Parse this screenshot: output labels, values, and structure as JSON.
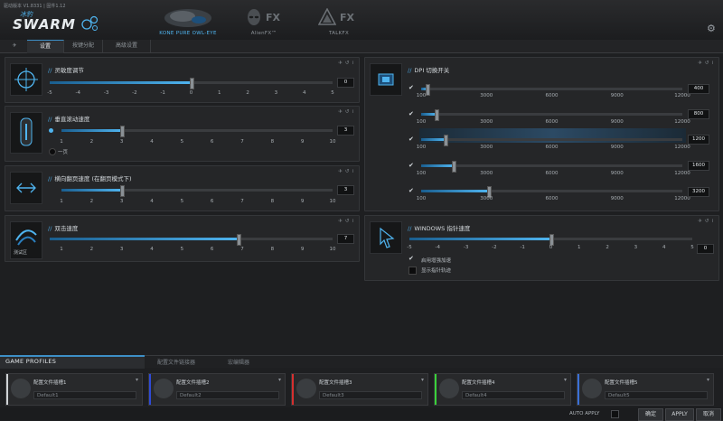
{
  "header": {
    "version_text": "驱动版本 V1.8331 | 固件1.12",
    "brand_cn": "冰豹",
    "brand": "SWARM",
    "nav": [
      {
        "label": "KONE PURE OWL-EYE"
      },
      {
        "label": "AlienFX™"
      },
      {
        "label": "TALKFX"
      }
    ],
    "fx_mark": "FX"
  },
  "tabs": [
    {
      "label": "✈"
    },
    {
      "label": "设置"
    },
    {
      "label": "按键分配"
    },
    {
      "label": "高级设置"
    }
  ],
  "panels": {
    "sensitivity": {
      "title": "灵敏度调节",
      "ticks": [
        "-5",
        "-4",
        "-3",
        "-2",
        "-1",
        "0",
        "1",
        "2",
        "3",
        "4",
        "5"
      ],
      "value": "0",
      "level": 0.5
    },
    "vscroll": {
      "title": "垂直滚动速度",
      "ticks": [
        "1",
        "2",
        "3",
        "4",
        "5",
        "6",
        "7",
        "8",
        "9",
        "10"
      ],
      "value": "3",
      "level": 0.222,
      "option": "一页"
    },
    "hscroll": {
      "title": "横向翻页速度 (在翻页模式下)",
      "ticks": [
        "1",
        "2",
        "3",
        "4",
        "5",
        "6",
        "7",
        "8",
        "9",
        "10"
      ],
      "value": "3",
      "level": 0.222
    },
    "dblclick": {
      "title": "双击速度",
      "ticks": [
        "1",
        "2",
        "3",
        "4",
        "5",
        "6",
        "7",
        "8",
        "9",
        "10"
      ],
      "value": "7",
      "level": 0.667,
      "thumb_label": "测试区"
    },
    "dpi": {
      "title": "DPI 切换开关",
      "ticks": [
        "100",
        "3000",
        "6000",
        "9000",
        "12000"
      ],
      "levels": [
        {
          "value": "400",
          "level": 0.025
        },
        {
          "value": "800",
          "level": 0.059
        },
        {
          "value": "1200",
          "level": 0.092
        },
        {
          "value": "1600",
          "level": 0.126
        },
        {
          "value": "3200",
          "level": 0.26
        }
      ]
    },
    "pointer": {
      "title": "WINDOWS 指针速度",
      "ticks": [
        "-5",
        "-4",
        "-3",
        "-2",
        "-1",
        "0",
        "1",
        "2",
        "3",
        "4",
        "5"
      ],
      "value": "0",
      "level": 0.5,
      "opt1": "启用增强加速",
      "opt2": "显示指针轨迹"
    }
  },
  "profiles": {
    "section_label": "GAME PROFILES",
    "tab2": "配置文件链接器",
    "tab3": "宏编辑器",
    "slots": [
      {
        "name": "配置文件插槽1",
        "default": "Default1",
        "accent": "#cfd3d6"
      },
      {
        "name": "配置文件插槽2",
        "default": "Default2",
        "accent": "#2f4bd6"
      },
      {
        "name": "配置文件插槽3",
        "default": "Default3",
        "accent": "#d62f2f"
      },
      {
        "name": "配置文件插槽4",
        "default": "Default4",
        "accent": "#3ad13a"
      },
      {
        "name": "配置文件插槽5",
        "default": "Default5",
        "accent": "#3a6fd6"
      }
    ]
  },
  "footer": {
    "auto_apply": "AUTO APPLY",
    "ok": "确定",
    "apply": "APPLY",
    "cancel": "取消"
  },
  "colors": {
    "accent": "#4fb4ef",
    "bg": "#1e1f21"
  }
}
